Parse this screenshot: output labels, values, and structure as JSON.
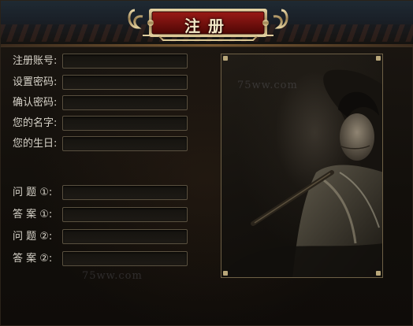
{
  "window": {
    "title": "注册"
  },
  "form": {
    "fields": [
      {
        "label": "注册账号:",
        "value": ""
      },
      {
        "label": "设置密码:",
        "value": ""
      },
      {
        "label": "确认密码:",
        "value": ""
      },
      {
        "label": "您的名字:",
        "value": ""
      },
      {
        "label": "您的生日:",
        "value": ""
      }
    ],
    "security": [
      {
        "label": "问 题 ①:",
        "value": ""
      },
      {
        "label": "答 案 ①:",
        "value": ""
      },
      {
        "label": "问 题 ②:",
        "value": ""
      },
      {
        "label": "答 案 ②:",
        "value": ""
      }
    ]
  },
  "watermark": {
    "text1": "75ww.com",
    "text2": "75ww.com"
  },
  "colors": {
    "title_red": "#7a0d0d",
    "gold": "#b9a77a"
  }
}
